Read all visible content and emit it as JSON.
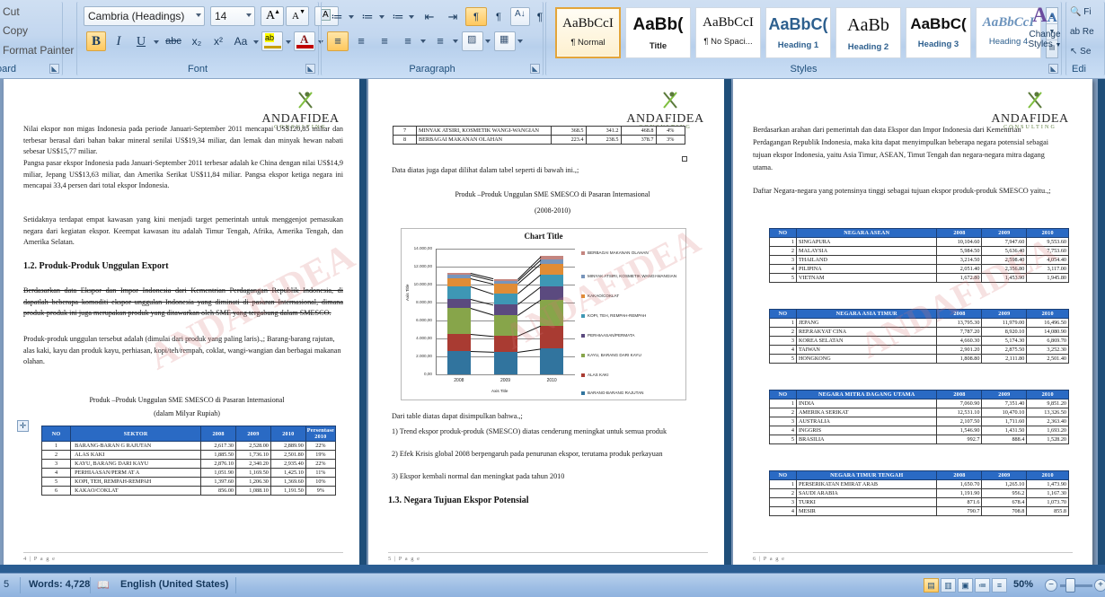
{
  "app": {
    "status_words": "Words: 4,728",
    "status_language": "English (United States)",
    "status_page_left": "5",
    "zoom_level": "50%"
  },
  "ribbon": {
    "clipboard": {
      "items": [
        "Cut",
        "Copy",
        "Format Painter"
      ],
      "group_label": "oard"
    },
    "font": {
      "group_label": "Font",
      "font_name": "Cambria (Headings)",
      "font_size": "14",
      "grow_font": "A",
      "shrink_font": "A",
      "clear_formatting": "A",
      "bold": "B",
      "italic": "I",
      "underline": "U",
      "strikethrough": "abc",
      "subscript": "x₂",
      "superscript": "x²",
      "change_case": "Aa",
      "highlight": "ab",
      "font_color": "A"
    },
    "paragraph": {
      "group_label": "Paragraph",
      "bullets": "≔",
      "numbering": "≔",
      "multilevel": "≔",
      "decrease_indent": "⇤",
      "increase_indent": "⇥",
      "ltr": "¶",
      "rtl": "¶",
      "sort": "A↓",
      "show_marks": "¶",
      "align_left": "≡",
      "align_center": "≡",
      "align_right": "≡",
      "justify": "≡",
      "line_spacing": "≡",
      "shading": "▨",
      "borders": "▦"
    },
    "styles": {
      "group_label": "Styles",
      "change_styles_label": "Change\nStyles",
      "change_styles_line1": "Change",
      "change_styles_line2": "Styles",
      "gallery": [
        {
          "preview": "AaBbCcI",
          "name": "¶ Normal",
          "selected": true
        },
        {
          "preview": "AaBb(",
          "name": "Title",
          "selected": false
        },
        {
          "preview": "AaBbCcI",
          "name": "¶ No Spaci...",
          "selected": false
        },
        {
          "preview": "AaBbC(",
          "name": "Heading 1",
          "selected": false
        },
        {
          "preview": "AaBb",
          "name": "Heading 2",
          "selected": false
        },
        {
          "preview": "AaBbC(",
          "name": "Heading 3",
          "selected": false
        },
        {
          "preview": "AaBbCcI",
          "name": "Heading 4",
          "selected": false
        }
      ]
    },
    "editing": {
      "group_label": "Edi",
      "find": "Fi",
      "replace": "Re",
      "select": "Se"
    }
  },
  "logo": {
    "name": "ANDAFIDEA",
    "subtitle": "CONSULTING"
  },
  "page4": {
    "number": "4 | P a g e",
    "paragraphs": [
      "Nilai ekspor non migas Indonesia pada periode Januari-September 2011 mencapai US$120,85 miliar dan terbesar berasal dari bahan bakar mineral senilai US$19,34 miliar, dan lemak dan minyak hewan nabati sebesar US$15,77 miliar.",
      "Pangsa pasar ekspor Indonesia pada Januari-September 2011 terbesar adalah ke China dengan nilai US$14,9 miliar, Jepang US$13,63 miliar, dan Amerika Serikat US$11,84 miliar. Pangsa ekspor ketiga negara ini mencapai 33,4 persen dari total ekspor Indonesia.",
      "Setidaknya terdapat empat kawasan yang kini menjadi target pemerintah untuk menggenjot pemasukan negara dari kegiatan ekspor. Keempat kawasan itu adalah Timur Tengah, Afrika, Amerika Tengah, dan Amerika Selatan."
    ],
    "heading": "1.2.   Produk-Produk  Unggulan  Export",
    "revised_text": "Berdasarkan data Ekspor dan Impor Indonesia dari Kementrian Perdagangan Republik Indonesia, di dapatlah beberapa komoditi ekspor unggulan Indonesia yang diminati di pasaran Internasional, dimana produk-produk  ini juga merupakan produk yang ditawarkan oleh SME yang tergabung dalam SMESCO.",
    "normal_text": "Produk-produk unggulan tersebut adalah (dimulai dari produk  yang paling laris).,; Barang-barang rajutan, alas kaki, kayu dan produk kayu, perhiasan, kopi/teh/rempah, coklat, wangi-wangian dan berbagai makanan olahan.",
    "table_caption_1": "Produk –Produk Unggulan SME SMESCO di Pasaran Internasional",
    "table_caption_2": "(dalam Milyar Rupiah)",
    "table": {
      "headers": [
        "NO",
        "SEKTOR",
        "2008",
        "2009",
        "2010",
        "Persentase 2010"
      ],
      "rows": [
        [
          "1",
          "BARANG-BARAN G   RAJUTAN",
          "2,617.30",
          "2,528.00",
          "2,889.90",
          "22%"
        ],
        [
          "2",
          "ALAS KAKI",
          "1,885.50",
          "1,736.10",
          "2,501.80",
          "19%"
        ],
        [
          "3",
          "KAYU, BARANG  DARI KAYU",
          "2,876.10",
          "2,340.20",
          "2,935.40",
          "22%"
        ],
        [
          "4",
          "PERHIAASAN/PERM AT A",
          "1,051.90",
          "1,169.50",
          "1,425.10",
          "11%"
        ],
        [
          "5",
          "KOPI, TEH, REMPAH-REMPAH",
          "1,397.60",
          "1,206.30",
          "1,369.60",
          "10%"
        ],
        [
          "6",
          "KAKAO/COKLAT",
          "856.00",
          "1,088.10",
          "1,191.50",
          "9%"
        ]
      ]
    }
  },
  "page5": {
    "number": "5 | P a g e",
    "table_cont": {
      "rows": [
        [
          "7",
          "MINYAK ATSIRI, KOSMETIK WANGI-WANGIAN",
          "368.5",
          "341.2",
          "468.8",
          "4%"
        ],
        [
          "8",
          "BERBAGAI MAKANAN  OLAHAN",
          "223.4",
          "238.5",
          "378.7",
          "3%"
        ]
      ]
    },
    "lead_text": "Data diatas juga dapat dilihat dalam tabel seperti di bawah ini.,;",
    "chart_caption_1": "Produk –Produk Unggulan SME SMESCO di Pasaran Internasional",
    "chart_caption_2": "(2008-2010)",
    "conclusion_lead": "Dari table diatas dapat disimpulkan bahwa.,;",
    "conclusions": [
      "1) Trend ekspor produk-produk  (SMESCO) diatas cenderung meningkat untuk semua produk",
      "2)  Efek Krisis global 2008 berpengaruh pada penurunan ekspor, terutama produk perkayuan",
      "3) Ekspor kembali normal dan meningkat pada tahun  2010"
    ],
    "heading": "1.3.   Negara Tujuan Ekspor Potensial"
  },
  "page6": {
    "number": "6 | P a g e",
    "paragraphs": [
      "Berdasarkan arahan dari pemerintah dan data Ekspor dan Impor Indonesia dari Kementrian Perdagangan Republik Indonesia, maka kita dapat menyimpulkan beberapa negara potensial sebagai tujuan ekspor Indonesia, yaitu Asia Timur, ASEAN, Timut Tengah dan negara-negara mitra dagang utama.",
      "Daftar Negara-negara yang potensinya tinggi sebagai tujuan ekspor produk-produk SMESCO yaitu.,;"
    ],
    "tables": [
      {
        "headers": [
          "NO",
          "NEGARA ASEAN",
          "2008",
          "2009",
          "2010"
        ],
        "rows": [
          [
            "1",
            "SINGAPURA",
            "10,104.60",
            "7,947.60",
            "9,553.60"
          ],
          [
            "2",
            "MALAYSIA",
            "5,984.50",
            "5,636.40",
            "7,753.60"
          ],
          [
            "3",
            "THAILAND",
            "3,214.50",
            "2,598.40",
            "4,054.40"
          ],
          [
            "4",
            "PILIPINA",
            "2,051.40",
            "2,356.80",
            "3,117.00"
          ],
          [
            "5",
            "VIETNAM",
            "1,672.80",
            "1,453.90",
            "1,945.80"
          ]
        ]
      },
      {
        "headers": [
          "NO",
          "NEGARA ASIA TIMUR",
          "2008",
          "2009",
          "2010"
        ],
        "rows": [
          [
            "1",
            "JEPANG",
            "13,795.30",
            "11,979.00",
            "16,496.50"
          ],
          [
            "2",
            "REP.RAKYAT  CINA",
            "7,787.20",
            "8,920.10",
            "14,080.90"
          ],
          [
            "3",
            "KOREA SELATAN",
            "4,660.30",
            "5,174.30",
            "6,869.70"
          ],
          [
            "4",
            "TAIWAN",
            "2,901.20",
            "2,875.50",
            "3,252.30"
          ],
          [
            "5",
            "HONGKONG",
            "1,808.80",
            "2,111.80",
            "2,501.40"
          ]
        ]
      },
      {
        "headers": [
          "NO",
          "NEGARA MITRA DAGANG UTAMA",
          "2008",
          "2009",
          "2010"
        ],
        "rows": [
          [
            "1",
            "INDIA",
            "7,060.90",
            "7,351.40",
            "9,851.20"
          ],
          [
            "2",
            "AMERIKA SERIKAT",
            "12,531.10",
            "10,470.10",
            "13,326.50"
          ],
          [
            "3",
            "AUSTRALIA",
            "2,107.50",
            "1,711.60",
            "2,363.40"
          ],
          [
            "4",
            "INGGRIS",
            "1,546.90",
            "1,431.50",
            "1,693.20"
          ],
          [
            "5",
            "BRASILIA",
            "992.7",
            "888.4",
            "1,528.20"
          ]
        ]
      },
      {
        "headers": [
          "NO",
          "NEGARA TIMUR TENGAH",
          "2008",
          "2009",
          "2010"
        ],
        "rows": [
          [
            "1",
            "PERSERIKATAN   EMIRAT  ARAB",
            "1,650.70",
            "1,265.10",
            "1,473.90"
          ],
          [
            "2",
            "SAUDI ARABIA",
            "1,191.90",
            "956.2",
            "1,167.30"
          ],
          [
            "3",
            "TURKI",
            "871.6",
            "678.4",
            "1,073.70"
          ],
          [
            "4",
            "MESIR",
            "790.7",
            "708.8",
            "855.8"
          ]
        ]
      }
    ]
  },
  "chart_data": {
    "type": "bar",
    "title": "Chart Title",
    "xlabel": "Axis Title",
    "ylabel": "Axis Title",
    "categories": [
      "2008",
      "2009",
      "2010"
    ],
    "ylim": [
      0,
      14000
    ],
    "yticks": [
      "0,00",
      "2.000,00",
      "4.000,00",
      "6.000,00",
      "8.000,00",
      "10.000,00",
      "12.000,00",
      "14.000,00"
    ],
    "grid": true,
    "legend_position": "right",
    "stacked": true,
    "series": [
      {
        "name": "BARANG-BARANG RAJUTAN",
        "color": "#31749e",
        "values": [
          2617.3,
          2528.0,
          2889.9
        ]
      },
      {
        "name": "ALAS KAKI",
        "color": "#a93b32",
        "values": [
          1885.5,
          1736.1,
          2501.8
        ]
      },
      {
        "name": "KAYU, BARANG DARI KAYU",
        "color": "#87a54a",
        "values": [
          2876.1,
          2340.2,
          2935.4
        ]
      },
      {
        "name": "PERHIAASAN/PERMATA",
        "color": "#5b4a7f",
        "values": [
          1051.9,
          1169.5,
          1425.1
        ]
      },
      {
        "name": "KOPI, TEH, REMPAH-REMPAH",
        "color": "#3e97b5",
        "values": [
          1397.6,
          1206.3,
          1369.6
        ]
      },
      {
        "name": "KAKAO/COKLAT",
        "color": "#e08c35",
        "values": [
          856.0,
          1088.1,
          1191.5
        ]
      },
      {
        "name": "MINYAK ATSIRI, KOSMETIK WANGI-WANGIAN",
        "color": "#7795bb",
        "values": [
          368.5,
          341.2,
          468.8
        ]
      },
      {
        "name": "BERBAGAI MAKANAN OLAHAN",
        "color": "#c4857f",
        "values": [
          223.4,
          238.5,
          378.7
        ]
      }
    ],
    "legend_order": [
      "BERBAGAI MAKANAN OLAHAN",
      "MINYAK ATSIRI, KOSMETIK WANGI-WANGIAN",
      "KAKAO/COKLAT",
      "KOPI, TEH, REMPAH-REMPAH",
      "PERHIAASAN/PERMATA",
      "KAYU, BARANG DARI KAYU",
      "ALAS KAKI",
      "BARANG-BARANG RAJUTAN"
    ]
  }
}
